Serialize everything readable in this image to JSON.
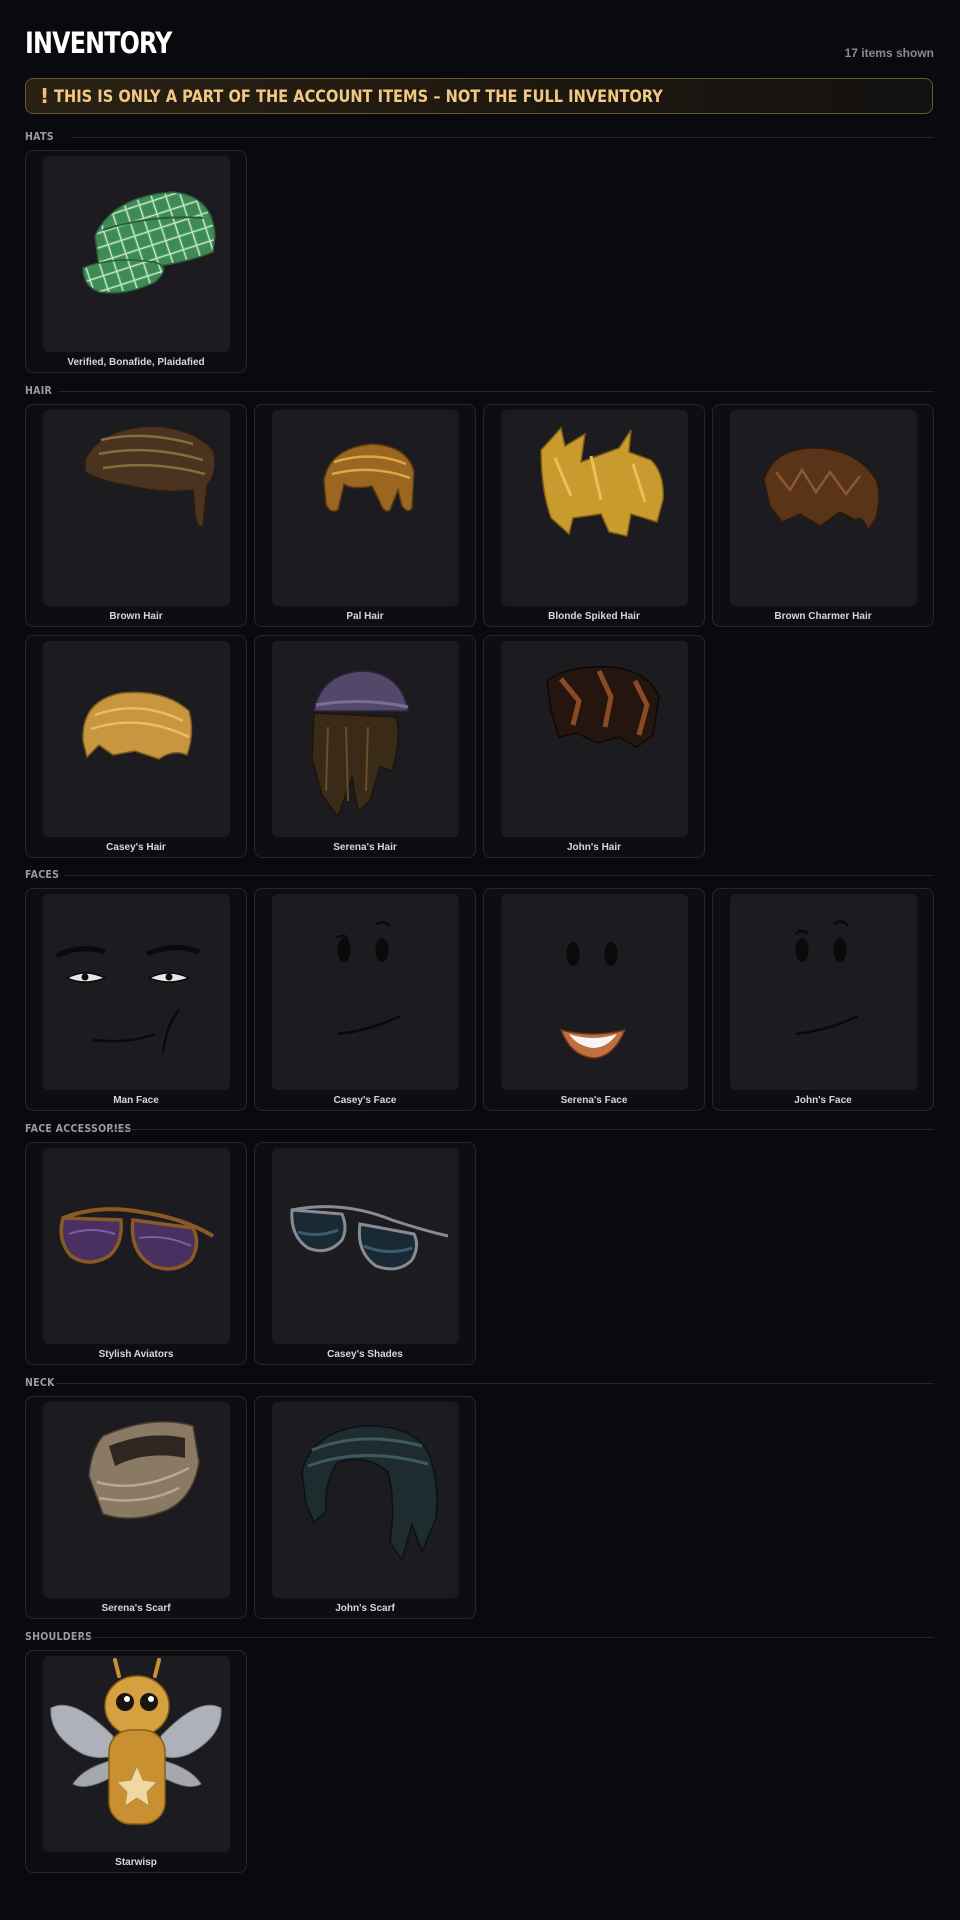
{
  "header": {
    "title": "INVENTORY",
    "count": "17 items shown"
  },
  "banner": {
    "icon": "!",
    "text": "THIS IS ONLY A PART OF THE ACCOUNT ITEMS – NOT THE FULL INVENTORY"
  },
  "sections": [
    {
      "label": "HATS",
      "items": [
        {
          "name": "Verified, Bonafide, Plaidafied",
          "icon": "plaid-cap-icon"
        }
      ]
    },
    {
      "label": "HAIR",
      "items": [
        {
          "name": "Brown Hair",
          "icon": "brown-hair-icon"
        },
        {
          "name": "Pal Hair",
          "icon": "pal-hair-icon"
        },
        {
          "name": "Blonde Spiked Hair",
          "icon": "blonde-spiked-hair-icon"
        },
        {
          "name": "Brown Charmer Hair",
          "icon": "brown-charmer-hair-icon"
        },
        {
          "name": "Casey's Hair",
          "icon": "casey-hair-icon"
        },
        {
          "name": "Serena's Hair",
          "icon": "serena-hair-icon"
        },
        {
          "name": "John's Hair",
          "icon": "john-hair-icon"
        }
      ]
    },
    {
      "label": "FACES",
      "items": [
        {
          "name": "Man Face",
          "icon": "man-face-icon"
        },
        {
          "name": "Casey's Face",
          "icon": "casey-face-icon"
        },
        {
          "name": "Serena's Face",
          "icon": "serena-face-icon"
        },
        {
          "name": "John's Face",
          "icon": "john-face-icon"
        }
      ]
    },
    {
      "label": "FACE ACCESSORIES",
      "items": [
        {
          "name": "Stylish Aviators",
          "icon": "aviators-icon"
        },
        {
          "name": "Casey's Shades",
          "icon": "shades-icon"
        }
      ]
    },
    {
      "label": "NECK",
      "items": [
        {
          "name": "Serena's Scarf",
          "icon": "beige-scarf-icon"
        },
        {
          "name": "John's Scarf",
          "icon": "dark-scarf-icon"
        }
      ]
    },
    {
      "label": "SHOULDERS",
      "items": [
        {
          "name": "Starwisp",
          "icon": "starwisp-icon"
        }
      ]
    }
  ]
}
